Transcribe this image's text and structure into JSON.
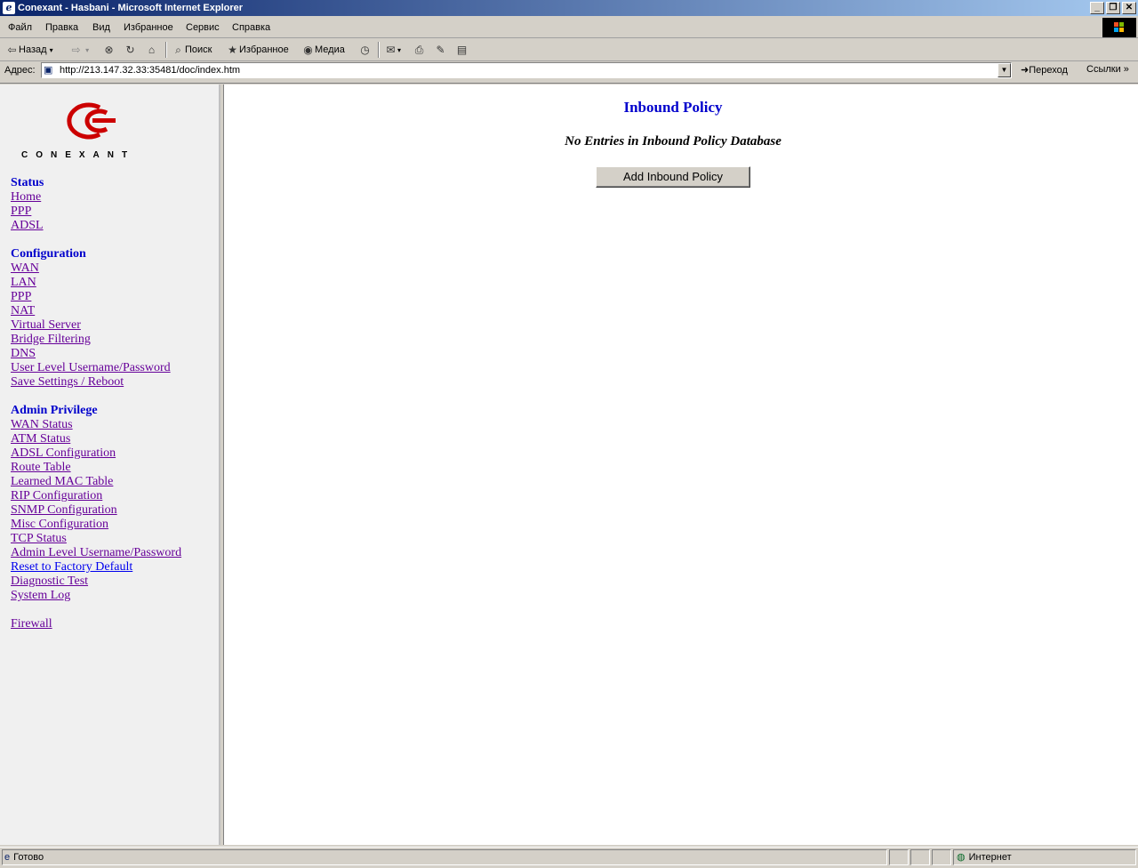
{
  "window": {
    "title": "Conexant - Hasbani - Microsoft Internet Explorer"
  },
  "menubar": {
    "items": [
      "Файл",
      "Правка",
      "Вид",
      "Избранное",
      "Сервис",
      "Справка"
    ]
  },
  "toolbar": {
    "back": "Назад",
    "search": "Поиск",
    "favorites": "Избранное",
    "media": "Медиа"
  },
  "address": {
    "label": "Адрес:",
    "url": "http://213.147.32.33:35481/doc/index.htm",
    "go": "Переход",
    "links": "Ссылки"
  },
  "sidebar": {
    "logo_text": "CONEXANT",
    "status": {
      "heading": "Status",
      "links": [
        "Home",
        "PPP",
        "ADSL"
      ]
    },
    "configuration": {
      "heading": "Configuration",
      "links": [
        "WAN",
        "LAN",
        "PPP",
        "NAT",
        "Virtual Server",
        "Bridge Filtering",
        "DNS",
        "User Level Username/Password",
        "Save Settings / Reboot"
      ]
    },
    "admin": {
      "heading": "Admin Privilege",
      "links": [
        "WAN Status",
        "ATM Status",
        "ADSL Configuration",
        "Route Table",
        "Learned MAC Table",
        "RIP Configuration",
        "SNMP Configuration",
        "Misc Configuration",
        "TCP Status",
        "Admin Level Username/Password",
        "Reset to Factory Default",
        "Diagnostic Test",
        "System Log"
      ]
    },
    "firewall": {
      "link": "Firewall"
    }
  },
  "main": {
    "heading": "Inbound Policy",
    "message": "No Entries in Inbound Policy Database",
    "add_button": "Add Inbound Policy"
  },
  "statusbar": {
    "status": "Готово",
    "zone": "Интернет"
  },
  "colors": {
    "heading": "#0000cc",
    "visited_link": "#660099",
    "link": "#0000ee",
    "logo_red": "#cc0000"
  }
}
